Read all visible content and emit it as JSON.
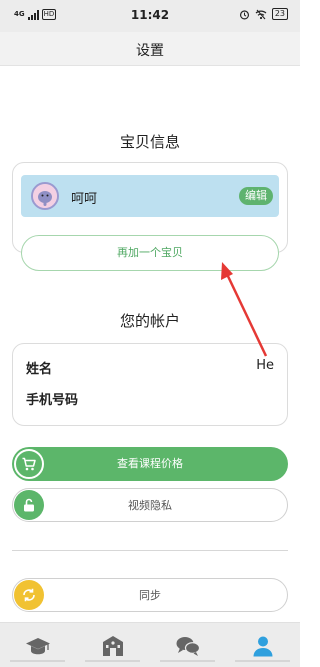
{
  "status_bar": {
    "signal_label": "4G",
    "hd_label": "HD",
    "time": "11:42",
    "battery": "23"
  },
  "header": {
    "title": "设置"
  },
  "baby_section": {
    "title": "宝贝信息",
    "babies": [
      {
        "name": "呵呵",
        "edit_label": "编辑"
      }
    ],
    "add_baby_label": "再加一个宝贝"
  },
  "account_section": {
    "title": "您的帐户",
    "name_label": "姓名",
    "name_value": "He",
    "phone_label": "手机号码",
    "phone_value": ""
  },
  "actions": {
    "view_price_label": "查看课程价格",
    "video_privacy_label": "视频隐私",
    "sync_label": "同步"
  },
  "tab_bar": {
    "items": [
      {
        "icon": "graduation-cap-icon"
      },
      {
        "icon": "school-icon"
      },
      {
        "icon": "chat-bubbles-icon"
      },
      {
        "icon": "user-icon",
        "active": true
      }
    ]
  },
  "colors": {
    "accent_green": "#5cb66a",
    "baby_row_bg": "#bde0f0",
    "sync_yellow": "#f1c232",
    "active_tab_blue": "#2fa0de",
    "annotation_red": "#e53935"
  }
}
